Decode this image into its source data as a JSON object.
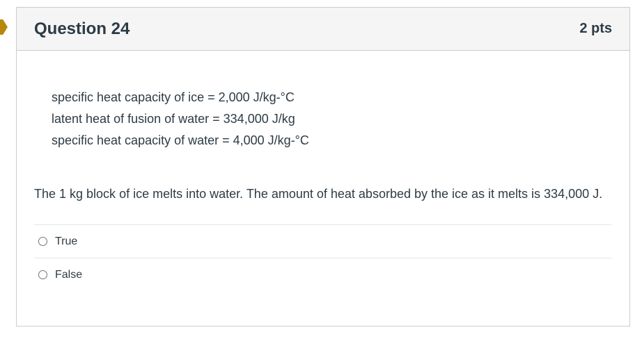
{
  "question": {
    "title": "Question 24",
    "points": "2 pts",
    "given": [
      "specific heat capacity of ice = 2,000 J/kg-°C",
      "latent heat of fusion of water = 334,000 J/kg",
      "specific heat capacity of water = 4,000 J/kg-°C"
    ],
    "text": "The 1 kg block of ice melts into water. The amount of heat absorbed by the ice as it melts is 334,000 J.",
    "answers": [
      {
        "label": "True",
        "selected": false
      },
      {
        "label": "False",
        "selected": false
      }
    ]
  },
  "colors": {
    "flag": "#b8860b",
    "header_bg": "#f5f5f5",
    "border": "#c7cdd1",
    "text": "#2d3b45"
  }
}
